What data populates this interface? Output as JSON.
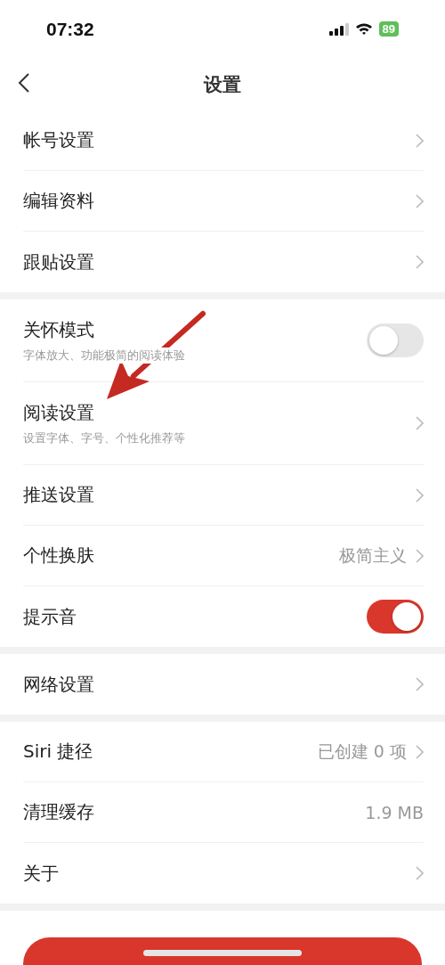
{
  "status_bar": {
    "time": "07:32",
    "battery": "89"
  },
  "header": {
    "title": "设置"
  },
  "sections": [
    {
      "rows": [
        {
          "kind": "nav",
          "title": "帐号设置"
        },
        {
          "kind": "nav",
          "title": "编辑资料"
        },
        {
          "kind": "nav",
          "title": "跟贴设置"
        }
      ]
    },
    {
      "rows": [
        {
          "kind": "toggle",
          "title": "关怀模式",
          "subtitle": "字体放大、功能极简的阅读体验",
          "on": false
        },
        {
          "kind": "nav",
          "title": "阅读设置",
          "subtitle": "设置字体、字号、个性化推荐等"
        },
        {
          "kind": "nav",
          "title": "推送设置"
        },
        {
          "kind": "nav",
          "title": "个性换肤",
          "value": "极简主义"
        },
        {
          "kind": "toggle",
          "title": "提示音",
          "on": true
        }
      ]
    },
    {
      "rows": [
        {
          "kind": "nav",
          "title": "网络设置"
        }
      ]
    },
    {
      "rows": [
        {
          "kind": "nav",
          "title": "Siri 捷径",
          "value": "已创建 0 项"
        },
        {
          "kind": "info",
          "title": "清理缓存",
          "value": "1.9 MB"
        },
        {
          "kind": "nav",
          "title": "关于"
        }
      ]
    }
  ]
}
